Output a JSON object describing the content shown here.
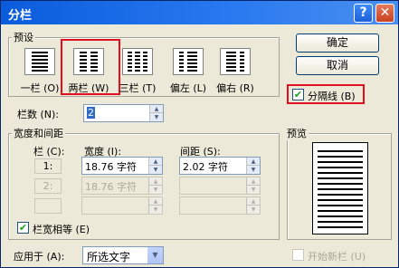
{
  "window": {
    "title": "分栏",
    "help_glyph": "?",
    "close_glyph": "✕"
  },
  "presets": {
    "group_label": "预设",
    "items": [
      {
        "label": "一栏 (O)",
        "icon": "one-column-icon"
      },
      {
        "label": "两栏 (W)",
        "icon": "two-column-icon",
        "selected": true
      },
      {
        "label": "三栏 (T)",
        "icon": "three-column-icon"
      },
      {
        "label": "偏左 (L)",
        "icon": "left-column-icon"
      },
      {
        "label": "偏右 (R)",
        "icon": "right-column-icon"
      }
    ]
  },
  "buttons": {
    "ok": "确定",
    "cancel": "取消"
  },
  "separator": {
    "label": "分隔线 (B)",
    "checked": true
  },
  "columns_count": {
    "label": "栏数 (N):",
    "value": "2"
  },
  "width_spacing": {
    "group_label": "宽度和间距",
    "col_header": "栏 (C):",
    "width_header": "宽度 (I):",
    "spacing_header": "间距 (S):",
    "rows": [
      {
        "col": "1:",
        "width": "18.76 字符",
        "spacing": "2.02 字符",
        "enabled": true
      },
      {
        "col": "2:",
        "width": "18.76 字符",
        "spacing": "",
        "enabled": false
      },
      {
        "col": "",
        "width": "",
        "spacing": "",
        "enabled": false
      }
    ]
  },
  "equal_width": {
    "label": "栏宽相等 (E)",
    "checked": true
  },
  "apply_to": {
    "label": "应用于 (A):",
    "value": "所选文字"
  },
  "preview": {
    "label": "预览"
  },
  "new_column": {
    "label": "开始新栏 (U)",
    "checked": false,
    "enabled": false
  },
  "colors": {
    "highlight": "#e0101e",
    "title_bar": "#0a5cdc",
    "dialog_bg": "#ece9d8"
  }
}
